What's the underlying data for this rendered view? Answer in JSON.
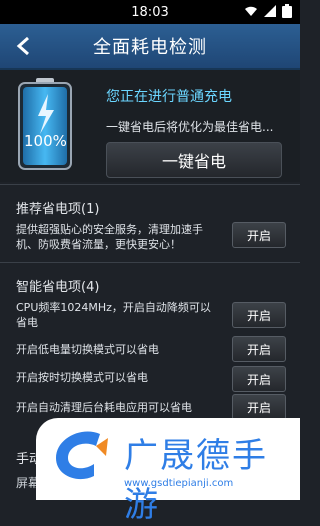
{
  "status": {
    "time": "18:03"
  },
  "header": {
    "title": "全面耗电检测"
  },
  "hero": {
    "battery_label": "100%",
    "charging_status": "您正在进行普通充电",
    "optimize_note": "一键省电后将优化为最佳省电...",
    "save_button": "一键省电"
  },
  "recommended": {
    "title": "推荐省电项(1)",
    "items": [
      {
        "text": "提供超强贴心的安全服务，清理加速手机、防吸费省流量，更快更安心！",
        "button": "开启"
      }
    ]
  },
  "smart": {
    "title": "智能省电项(4)",
    "items": [
      {
        "text": "CPU频率1024MHz，开启自动降频可以省电",
        "button": "开启"
      },
      {
        "text": "开启低电量切换模式可以省电",
        "button": "开启"
      },
      {
        "text": "开启按时切换模式可以省电",
        "button": "开启"
      },
      {
        "text": "开启自动清理后台耗电应用可以省电",
        "button": "开启"
      }
    ]
  },
  "manual": {
    "title": "手动",
    "subtitle": "屏幕"
  },
  "watermark": {
    "name": "广晟德手游",
    "url": "www.gsdtiepianji.com"
  },
  "colors": {
    "header": "#2c5f93",
    "accent": "#6bd6ff",
    "battery": "#3aa7e8"
  },
  "icons": [
    "back-arrow-icon",
    "wifi-icon",
    "signal-icon",
    "battery-icon",
    "lightning-icon"
  ]
}
